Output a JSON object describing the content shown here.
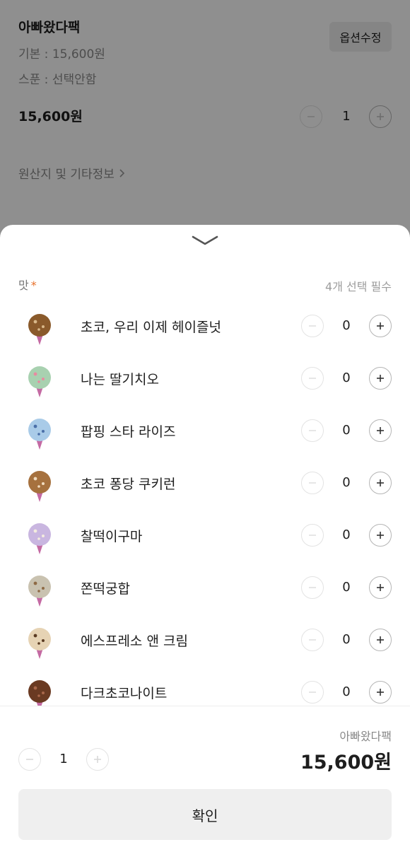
{
  "background_page": {
    "product_title": "아빠왔다팩",
    "detail_base": "기본 : 15,600원",
    "detail_spoon": "스푼 : 선택안함",
    "edit_options_label": "옵션수정",
    "price": "15,600원",
    "quantity": "1",
    "origin_link": "원산지 및 기타정보"
  },
  "sheet": {
    "flavor_section": {
      "title": "맛",
      "required_marker": "*",
      "requirement_text": "4개 선택 필수"
    },
    "flavors": [
      {
        "name": "초코, 우리 이제 헤이즐넛",
        "quantity": "0",
        "scoop_color": "#8a5a2b",
        "topping_color": "#d9b88a"
      },
      {
        "name": "나는 딸기치오",
        "quantity": "0",
        "scoop_color": "#a8d1b0",
        "topping_color": "#e88aa0"
      },
      {
        "name": "팝핑 스타 라이즈",
        "quantity": "0",
        "scoop_color": "#a9cbe8",
        "topping_color": "#4a6fa8"
      },
      {
        "name": "초코 퐁당 쿠키런",
        "quantity": "0",
        "scoop_color": "#a6713e",
        "topping_color": "#f1dcc0"
      },
      {
        "name": "찰떡이구마",
        "quantity": "0",
        "scoop_color": "#c9b6e0",
        "topping_color": "#f3ecde"
      },
      {
        "name": "쫀떡궁합",
        "quantity": "0",
        "scoop_color": "#c9c2b0",
        "topping_color": "#8e6a45"
      },
      {
        "name": "에스프레소 앤 크림",
        "quantity": "0",
        "scoop_color": "#e6d3b4",
        "topping_color": "#5a3b22"
      },
      {
        "name": "다크초코나이트",
        "quantity": "0",
        "scoop_color": "#6a3a22",
        "topping_color": "#a8674a"
      }
    ],
    "footer": {
      "product_name": "아빠왔다팩",
      "total_price": "15,600원",
      "quantity": "1"
    },
    "confirm_label": "확인"
  },
  "colors": {
    "accent_required": "#e8702a",
    "cone": "#c46aa3"
  }
}
